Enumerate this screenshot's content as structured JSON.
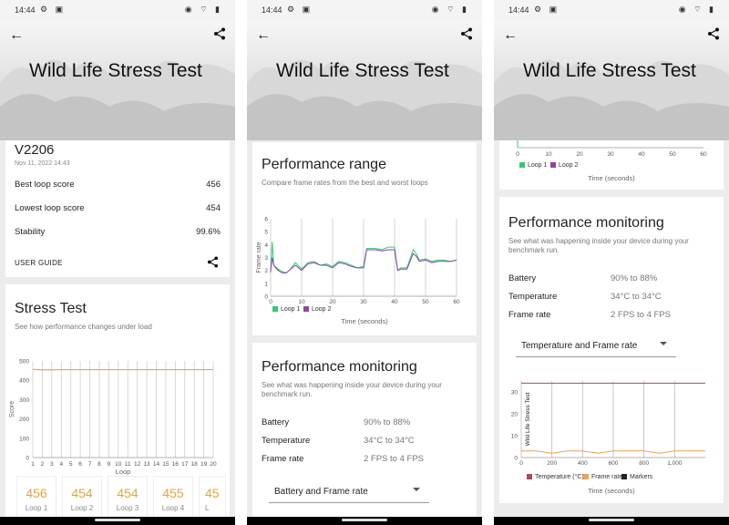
{
  "status": {
    "time": "14:44",
    "left_icons": "⚙ ▣",
    "right_icons": "◉ ⌔ ▮"
  },
  "header": {
    "title": "Wild Life Stress Test"
  },
  "colors": {
    "loop1": "#2ecc71",
    "loop2": "#8e44ad",
    "score_line": "#f0a050",
    "temperature": "#a24d5c",
    "frame_rate": "#f0a050",
    "markers": "#222222"
  },
  "panel1": {
    "device": "V2206",
    "date": "Nov 11, 2022 14:43",
    "rows": [
      {
        "label": "Best loop score",
        "value": "456"
      },
      {
        "label": "Lowest loop score",
        "value": "454"
      },
      {
        "label": "Stability",
        "value": "99.6%"
      }
    ],
    "user_guide": "USER GUIDE",
    "stress": {
      "title": "Stress Test",
      "subtitle": "See how performance changes under load"
    },
    "loops": [
      {
        "value": "456",
        "label": "Loop 1"
      },
      {
        "value": "454",
        "label": "Loop 2"
      },
      {
        "value": "454",
        "label": "Loop 3"
      },
      {
        "value": "455",
        "label": "Loop 4"
      },
      {
        "value": "45",
        "label": "L"
      }
    ]
  },
  "panel2": {
    "range": {
      "title": "Performance range",
      "subtitle": "Compare frame rates from the best and worst loops"
    },
    "monitoring": {
      "title": "Performance monitoring",
      "subtitle": "See what was happening inside your device during your benchmark run."
    },
    "rows": [
      {
        "label": "Battery",
        "value": "90% to 88%"
      },
      {
        "label": "Temperature",
        "value": "34°C to 34°C"
      },
      {
        "label": "Frame rate",
        "value": "2 FPS to 4 FPS"
      }
    ],
    "dropdown": "Battery and Frame rate"
  },
  "panel3": {
    "monitoring": {
      "title": "Performance monitoring",
      "subtitle": "See what was happening inside your device during your benchmark run."
    },
    "rows": [
      {
        "label": "Battery",
        "value": "90% to 88%"
      },
      {
        "label": "Temperature",
        "value": "34°C to 34°C"
      },
      {
        "label": "Frame rate",
        "value": "2 FPS to 4 FPS"
      }
    ],
    "dropdown": "Temperature and Frame rate"
  },
  "chart_data": [
    {
      "type": "line",
      "ylabel": "Score",
      "xlabel": "Loop",
      "x": [
        1,
        2,
        3,
        4,
        5,
        6,
        7,
        8,
        9,
        10,
        11,
        12,
        13,
        14,
        15,
        16,
        17,
        18,
        19,
        20
      ],
      "ylim": [
        0,
        500
      ],
      "yticks": [
        0,
        100,
        200,
        300,
        400,
        500
      ],
      "series": [
        {
          "values": [
            456,
            454,
            454,
            455,
            455,
            455,
            455,
            455,
            455,
            455,
            455,
            455,
            455,
            455,
            455,
            455,
            455,
            455,
            455,
            455
          ]
        }
      ]
    },
    {
      "type": "line",
      "ylabel": "Frame rate",
      "xlabel": "Time (seconds)",
      "xlim": [
        0,
        60
      ],
      "ylim": [
        0,
        6
      ],
      "xticks": [
        0,
        10,
        20,
        30,
        40,
        50,
        60
      ],
      "yticks": [
        0,
        1,
        2,
        3,
        4,
        5,
        6
      ],
      "legend": [
        "Loop 1",
        "Loop 2"
      ],
      "series": [
        {
          "name": "Loop 1",
          "x": [
            0,
            0.5,
            1,
            2,
            3,
            4,
            5,
            6,
            8,
            10,
            12,
            14,
            16,
            18,
            20,
            22,
            24,
            26,
            28,
            30,
            31,
            32,
            34,
            36,
            38,
            40,
            41,
            42,
            44,
            46,
            47,
            48,
            50,
            52,
            54,
            56,
            58,
            60
          ],
          "values": [
            1.8,
            4.2,
            2.4,
            2.2,
            2.0,
            1.9,
            1.8,
            2.0,
            2.6,
            2.1,
            2.6,
            2.7,
            2.4,
            2.5,
            2.3,
            2.7,
            2.6,
            2.4,
            2.2,
            2.3,
            3.7,
            3.7,
            3.7,
            3.6,
            3.8,
            3.8,
            2.0,
            2.2,
            2.2,
            3.6,
            3.3,
            2.8,
            2.9,
            2.7,
            2.8,
            2.8,
            2.7,
            2.8
          ]
        },
        {
          "name": "Loop 2",
          "x": [
            0,
            0.5,
            1,
            2,
            3,
            4,
            5,
            6,
            8,
            10,
            12,
            14,
            16,
            18,
            20,
            22,
            24,
            26,
            28,
            30,
            31,
            32,
            34,
            36,
            38,
            40,
            41,
            42,
            44,
            46,
            47,
            48,
            50,
            52,
            54,
            56,
            58,
            60
          ],
          "values": [
            1.9,
            3.0,
            2.4,
            2.1,
            1.9,
            1.8,
            1.8,
            2.0,
            2.4,
            2.0,
            2.5,
            2.6,
            2.4,
            2.4,
            2.2,
            2.6,
            2.5,
            2.3,
            2.2,
            2.2,
            3.6,
            3.6,
            3.6,
            3.5,
            3.6,
            3.6,
            2.0,
            2.1,
            2.1,
            3.3,
            3.1,
            2.7,
            2.8,
            2.6,
            2.7,
            2.7,
            2.7,
            2.8
          ]
        }
      ]
    },
    {
      "type": "line",
      "xlabel": "Time (seconds)",
      "xticks": [
        0,
        10,
        20,
        30,
        40,
        50,
        60
      ],
      "legend": [
        "Loop 1",
        "Loop 2"
      ]
    },
    {
      "type": "line",
      "ylabel": "Wild Life Stress Test",
      "xlabel": "Time (seconds)",
      "xlim": [
        0,
        1200
      ],
      "ylim": [
        0,
        35
      ],
      "xticks": [
        0,
        200,
        400,
        600,
        800,
        1000
      ],
      "xticklabels": [
        "0",
        "200",
        "400",
        "600",
        "800",
        "1,000"
      ],
      "yticks": [
        0,
        10,
        20,
        30
      ],
      "legend": [
        "Temperature (°C)",
        "Frame rate",
        "Markers"
      ],
      "series": [
        {
          "name": "Temperature (°C)",
          "x": [
            0,
            200,
            400,
            600,
            800,
            1000,
            1200
          ],
          "values": [
            34,
            34,
            34,
            34,
            34,
            34,
            34
          ]
        },
        {
          "name": "Frame rate",
          "x": [
            0,
            100,
            200,
            300,
            400,
            500,
            600,
            700,
            800,
            900,
            1000,
            1100,
            1200
          ],
          "values": [
            3,
            3,
            2,
            3,
            3,
            2,
            3,
            3,
            3,
            2,
            3,
            3,
            3
          ]
        }
      ],
      "markers": [
        0,
        200,
        400,
        600,
        800,
        1000
      ]
    }
  ]
}
